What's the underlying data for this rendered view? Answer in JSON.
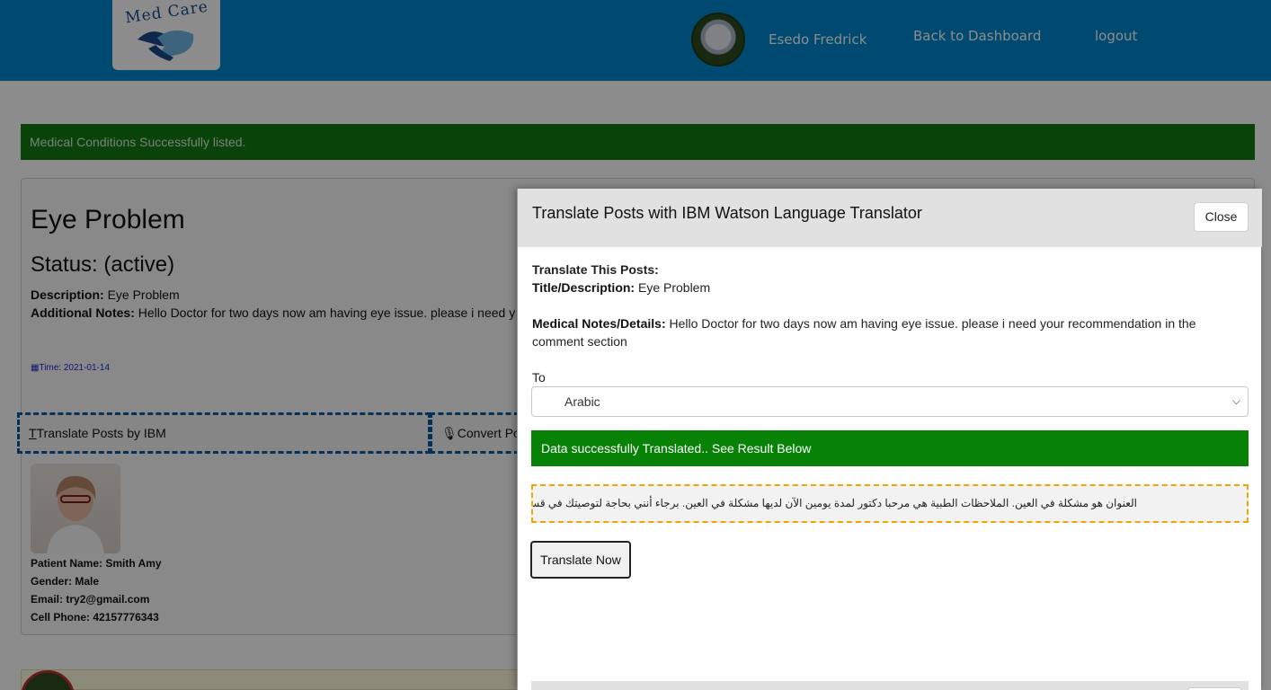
{
  "header": {
    "logo_text": "Med Care",
    "user_name": "Esedo Fredrick",
    "back_link": "Back to Dashboard",
    "logout_link": "logout"
  },
  "page": {
    "alert": "Medical Conditions Successfully listed.",
    "post": {
      "title": "Eye Problem",
      "status": "Status: (active)",
      "description_label": "Description:",
      "description": "Eye Problem",
      "notes_label": "Additional Notes:",
      "notes": "Hello Doctor for two days now am having eye issue. please i need y",
      "time": "Time: 2021-01-14",
      "translate_button": "Translate Posts by IBM",
      "convert_button": "Convert Pos"
    },
    "patient": {
      "name_label": "Patient Name:",
      "name": "Smith Amy",
      "gender_label": "Gender:",
      "gender": "Male",
      "email_label": "Email:",
      "email": "try2@gmail.com",
      "phone_label": "Cell Phone:",
      "phone": "42157776343"
    }
  },
  "modal": {
    "title": "Translate Posts with IBM Watson Language Translator",
    "close_label": "Close",
    "translate_heading": "Translate This Posts:",
    "title_desc_label": "Title/Description:",
    "title_desc": "Eye Problem",
    "notes_label": "Medical Notes/Details:",
    "notes_line1": "Hello Doctor for two days now am having eye issue. please i need your recommendation in the",
    "notes_line2": "comment section",
    "to_label": "To",
    "language_selected": "Arabic",
    "success_message": "Data successfully Translated.. See Result Below",
    "translated_text": "العنوان هو مشكلة في العين. الملاحظات الطبية هي مرحبا دكتور لمدة يومين الآن لديها مشكلة في العين. برجاء أنني بحاجة لتوصيتك في قسم التعليقات",
    "translate_button": "Translate Now"
  },
  "colors": {
    "header_blue": "#0188cf",
    "success_green": "#078207",
    "dashed_orange": "#f0a500",
    "dashed_blue": "#0a5aa0"
  }
}
